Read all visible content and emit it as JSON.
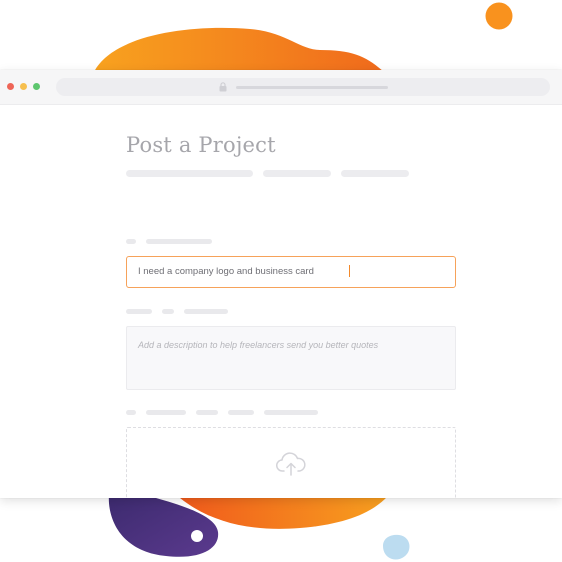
{
  "browser": {
    "traffic_lights": [
      "#ee6557",
      "#f6bf4f",
      "#5dc66e"
    ],
    "lock_icon": "lock-icon"
  },
  "form": {
    "title": "Post a Project",
    "title_input_value": "I need a company logo and business card",
    "description_placeholder": "Add a description to help freelancers send you better quotes",
    "upload_icon": "cloud-upload-icon"
  },
  "colors": {
    "accent": "#f7821f",
    "focus_border": "#f6a25a",
    "purple_blob": "#4a2f7c",
    "light_blue_blob": "#bcdcf0"
  }
}
